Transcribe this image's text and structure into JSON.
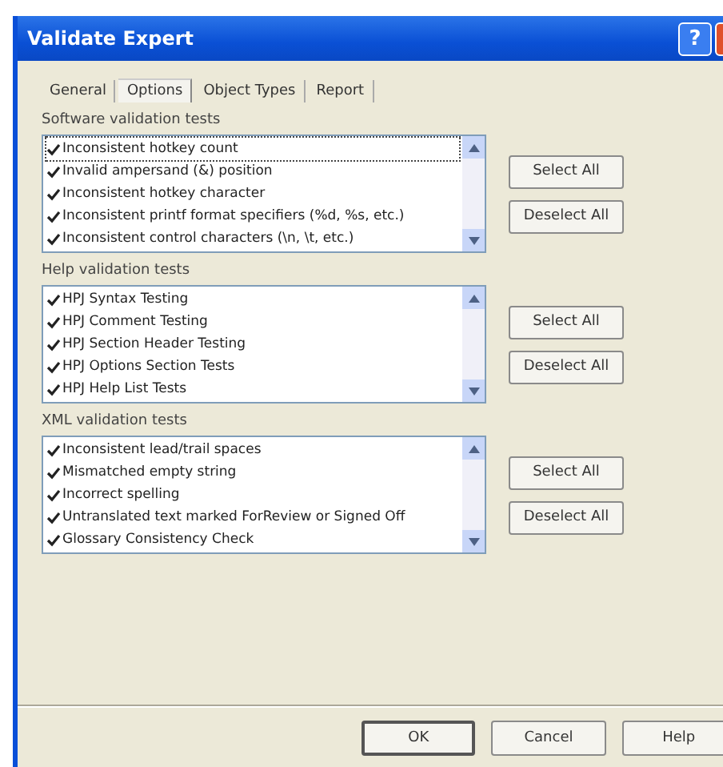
{
  "window": {
    "title": "Validate Expert",
    "help_glyph": "?"
  },
  "tabs": [
    {
      "label": "General",
      "selected": false
    },
    {
      "label": "Options",
      "selected": true
    },
    {
      "label": "Object Types",
      "selected": false
    },
    {
      "label": "Report",
      "selected": false
    }
  ],
  "groups": [
    {
      "label": "Software validation tests",
      "items": [
        {
          "label": "Inconsistent hotkey count",
          "checked": true,
          "focused": true
        },
        {
          "label": "Invalid ampersand (&) position",
          "checked": true,
          "focused": false
        },
        {
          "label": "Inconsistent hotkey character",
          "checked": true,
          "focused": false
        },
        {
          "label": "Inconsistent printf format specifiers (%d, %s, etc.)",
          "checked": true,
          "focused": false
        },
        {
          "label": "Inconsistent control characters (\\n, \\t, etc.)",
          "checked": true,
          "focused": false
        }
      ],
      "buttons": [
        "Select All",
        "Deselect All"
      ]
    },
    {
      "label": "Help validation tests",
      "items": [
        {
          "label": "HPJ Syntax Testing",
          "checked": true,
          "focused": false
        },
        {
          "label": "HPJ Comment Testing",
          "checked": true,
          "focused": false
        },
        {
          "label": "HPJ Section Header Testing",
          "checked": true,
          "focused": false
        },
        {
          "label": "HPJ Options Section Tests",
          "checked": true,
          "focused": false
        },
        {
          "label": "HPJ Help List Tests",
          "checked": true,
          "focused": false
        }
      ],
      "buttons": [
        "Select All",
        "Deselect All"
      ]
    },
    {
      "label": "XML validation tests",
      "items": [
        {
          "label": "Inconsistent lead/trail spaces",
          "checked": true,
          "focused": false
        },
        {
          "label": "Mismatched empty string",
          "checked": true,
          "focused": false
        },
        {
          "label": "Incorrect spelling",
          "checked": true,
          "focused": false
        },
        {
          "label": "Untranslated text marked ForReview or Signed Off",
          "checked": true,
          "focused": false
        },
        {
          "label": "Glossary Consistency Check",
          "checked": true,
          "focused": false
        }
      ],
      "buttons": [
        "Select All",
        "Deselect All"
      ]
    }
  ],
  "footer_buttons": [
    "OK",
    "Cancel",
    "Help"
  ]
}
